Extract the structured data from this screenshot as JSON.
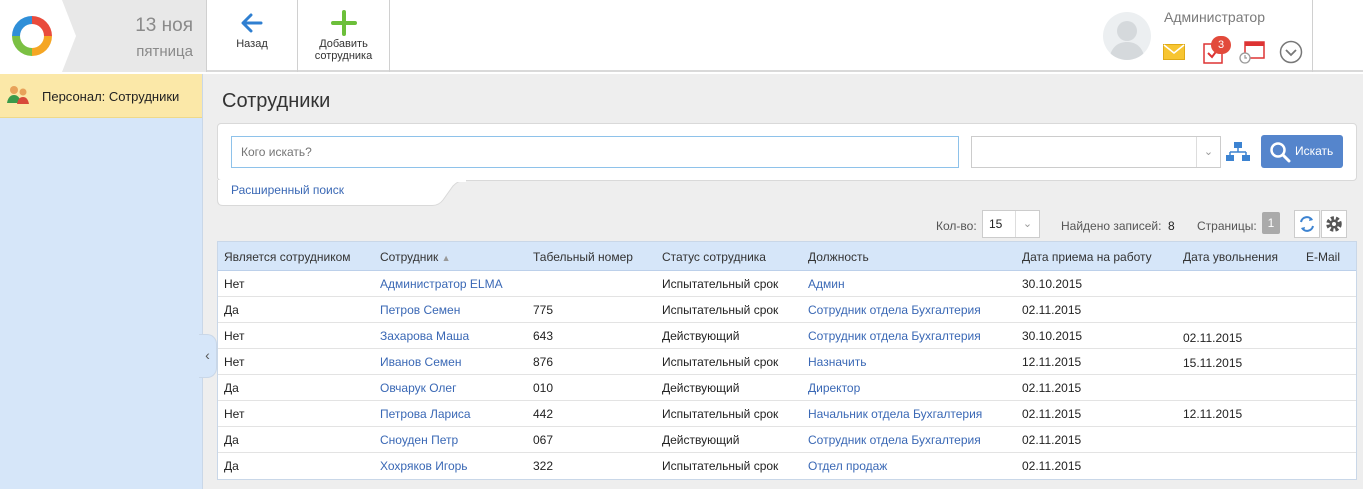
{
  "header": {
    "date_main": "13 ноя",
    "date_sub": "пятница",
    "back_label": "Назад",
    "add_label_line1": "Добавить",
    "add_label_line2": "сотрудника",
    "user_name": "Администратор",
    "tasks_badge": "3"
  },
  "sidebar": {
    "items": [
      {
        "label": "Персонал: Сотрудники",
        "icon": "people-icon"
      }
    ]
  },
  "main": {
    "title": "Сотрудники",
    "search": {
      "placeholder": "Кого искать?",
      "button_label": "Искать",
      "advanced_link": "Расширенный поиск"
    },
    "pager": {
      "count_label": "Кол-во:",
      "count_value": "15",
      "found_label": "Найдено записей:",
      "found_value": "8",
      "pages_label": "Страницы:",
      "page_current": "1"
    },
    "table": {
      "columns": [
        "Является сотрудником",
        "Сотрудник",
        "Табельный номер",
        "Статус сотрудника",
        "Должность",
        "Дата приема на работу",
        "Дата увольнения",
        "E-Mail"
      ],
      "rows": [
        {
          "is_employee": "Нет",
          "name": "Администратор ELMA",
          "tab_no": "",
          "status": "Испытательный срок",
          "position": "Админ",
          "hire_date": "30.10.2015",
          "fire_date": "",
          "email": ""
        },
        {
          "is_employee": "Да",
          "name": "Петров Семен",
          "tab_no": "775",
          "status": "Испытательный срок",
          "position": "Сотрудник отдела Бухгалтерия",
          "hire_date": "02.11.2015",
          "fire_date": "",
          "email": ""
        },
        {
          "is_employee": "Нет",
          "name": "Захарова Маша",
          "tab_no": "643",
          "status": "Действующий",
          "position": "Сотрудник отдела Бухгалтерия",
          "hire_date": "30.10.2015",
          "fire_date": "02.11.2015",
          "email": ""
        },
        {
          "is_employee": "Нет",
          "name": "Иванов Семен",
          "tab_no": "876",
          "status": "Испытательный срок",
          "position": "Назначить",
          "hire_date": "12.11.2015",
          "fire_date": "15.11.2015",
          "email": ""
        },
        {
          "is_employee": "Да",
          "name": "Овчарук Олег",
          "tab_no": "010",
          "status": "Действующий",
          "position": "Директор",
          "hire_date": "02.11.2015",
          "fire_date": "",
          "email": ""
        },
        {
          "is_employee": "Нет",
          "name": "Петрова Лариса",
          "tab_no": "442",
          "status": "Испытательный срок",
          "position": "Начальник отдела Бухгалтерия",
          "hire_date": "02.11.2015",
          "fire_date": "12.11.2015",
          "email": ""
        },
        {
          "is_employee": "Да",
          "name": "Сноуден Петр",
          "tab_no": "067",
          "status": "Действующий",
          "position": "Сотрудник отдела Бухгалтерия",
          "hire_date": "02.11.2015",
          "fire_date": "",
          "email": ""
        },
        {
          "is_employee": "Да",
          "name": "Хохряков Игорь",
          "tab_no": "322",
          "status": "Испытательный срок",
          "position": "Отдел продаж",
          "hire_date": "02.11.2015",
          "fire_date": "",
          "email": ""
        }
      ]
    }
  },
  "colors": {
    "accent_blue": "#5585cc",
    "link": "#3a68b5",
    "sidebar_bg": "#d6e6f9",
    "sidebar_active": "#fbe8a8",
    "add_green": "#6cbf3a",
    "badge_red": "#e24a3b"
  }
}
